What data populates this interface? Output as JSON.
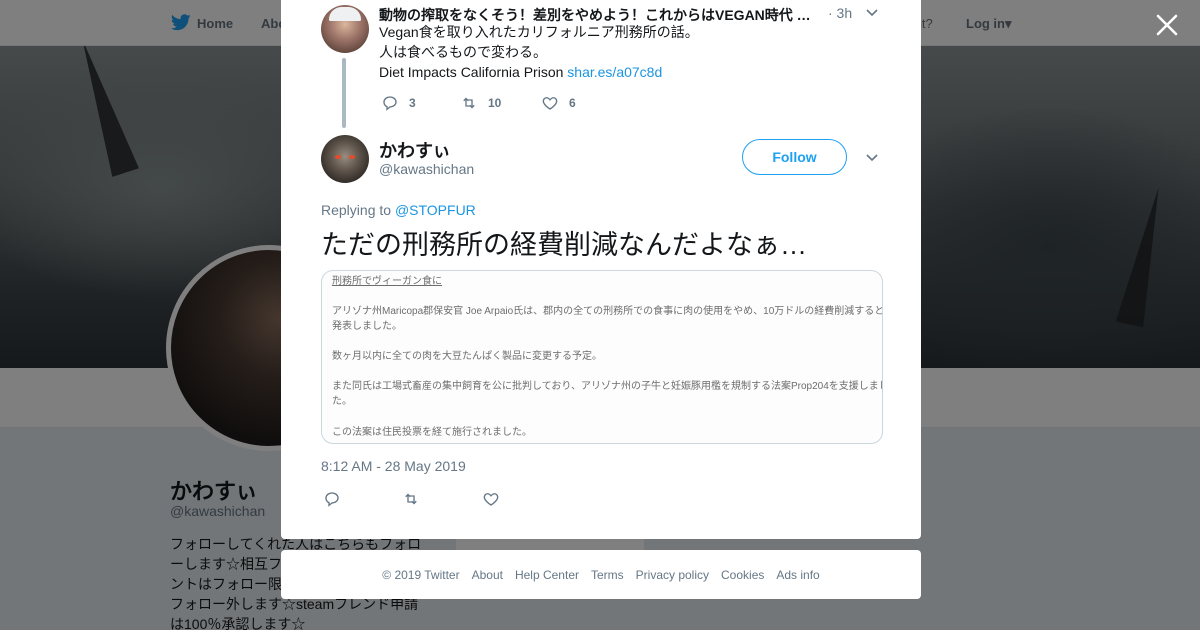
{
  "nav": {
    "home": "Home",
    "about": "Abo",
    "account_prompt": "account?",
    "login": "Log in"
  },
  "profile": {
    "name": "かわすぃ",
    "handle": "@kawashichan",
    "bio_lines": [
      "フォローしてくれた人はこちらもフォロ",
      "ーします☆相互フ",
      "ントはフォロー限",
      "フォロー外します☆steamフレンド申請",
      "は100％承認します☆"
    ]
  },
  "parent_tweet": {
    "name": "動物の搾取をなくそう！差別をやめよう！これからはVEGAN時代 …",
    "time": "· 3h",
    "lines": [
      "Vegan食を取り入れたカリフォルニア刑務所の話。",
      "人は食べるもので変わる。",
      "Diet Impacts California Prison"
    ],
    "link": "shar.es/a07c8d",
    "reply_count": "3",
    "retweet_count": "10",
    "like_count": "6"
  },
  "main_tweet": {
    "name": "かわすぃ",
    "handle": "@kawashichan",
    "follow_label": "Follow",
    "replying_prefix": "Replying to",
    "replying_mention": "@STOPFUR",
    "text": "ただの刑務所の経費削減なんだよなぁ…",
    "media_lines": [
      "刑務所でヴィーガン食に",
      "アリゾナ州Maricopa郡保安官 Joe Arpaio氏は、郡内の全ての刑務所での食事に肉の使用をやめ、10万ドルの経費削減すると",
      "発表しました。",
      "数ヶ月以内に全ての肉を大豆たんぱく製品に変更する予定。",
      "また同氏は工場式畜産の集中飼育を公に批判しており、アリゾナ州の子牛と妊娠豚用檻を規制する法案Prop204を支援しまし",
      "た。",
      "この法案は住民投票を経て施行されました。"
    ],
    "timestamp": "8:12 AM - 28 May 2019"
  },
  "footer": {
    "copyright": "© 2019 Twitter",
    "about": "About",
    "help": "Help Center",
    "terms": "Terms",
    "privacy": "Privacy policy",
    "cookies": "Cookies",
    "ads": "Ads info"
  },
  "colors": {
    "accent": "#1da1f2",
    "link": "#1b95e0",
    "muted": "#657786"
  },
  "icons": {
    "logo": "twitter-bird-icon",
    "close": "close-icon",
    "reply": "reply-icon",
    "retweet": "retweet-icon",
    "like": "heart-icon",
    "more": "chevron-down-icon"
  }
}
